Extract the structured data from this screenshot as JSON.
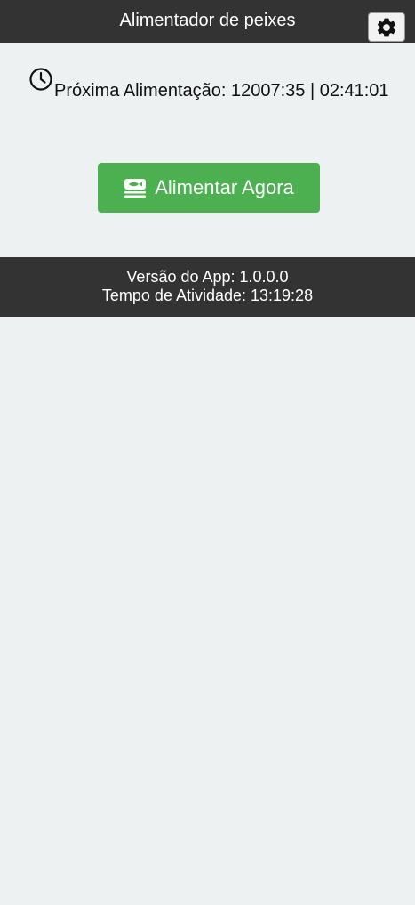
{
  "header": {
    "title": "Alimentador de peixes",
    "settings_icon": "gear-icon"
  },
  "schedule": {
    "icon": "clock-icon",
    "next_feed_text": "Próxima Alimentação: 12007:35 | 02:41:01"
  },
  "feed_button": {
    "icon": "fish-food-icon",
    "label": "Alimentar Agora"
  },
  "footer": {
    "version_text": "Versão do App: 1.0.0.0",
    "uptime_text": "Tempo de Atividade: 13:19:28"
  },
  "colors": {
    "header_bg": "#333333",
    "page_bg": "#eef1f2",
    "accent_green": "#4caf50"
  }
}
